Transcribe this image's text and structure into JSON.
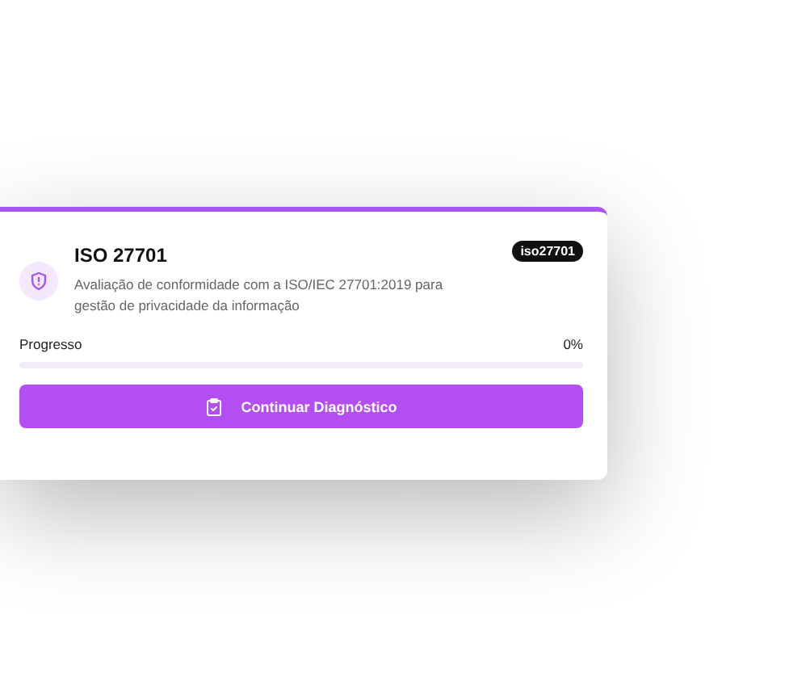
{
  "card": {
    "title": "ISO 27701",
    "badge": "iso27701",
    "description": "Avaliação de conformidade com a ISO/IEC 27701:2019 para gestão de privacidade da informação",
    "progress_label": "Progresso",
    "progress_value": "0%",
    "level": 0,
    "button": "Continuar Diagnóstico"
  }
}
